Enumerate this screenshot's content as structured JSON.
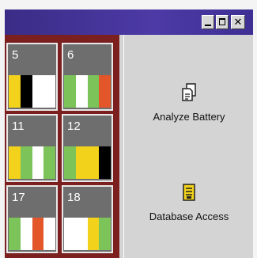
{
  "window": {
    "controls": {
      "minimize": "minimize",
      "maximize": "maximize",
      "close": "✕"
    }
  },
  "cells": [
    {
      "number": "5",
      "slots": [
        "#f2d21b",
        "#000000",
        "#ffffff",
        "#ffffff"
      ]
    },
    {
      "number": "6",
      "slots": [
        "#7cc35a",
        "#ffffff",
        "#7cc35a",
        "#e2562a"
      ]
    },
    {
      "number": "11",
      "slots": [
        "#f2d21b",
        "#7cc35a",
        "#ffffff",
        "#7cc35a"
      ]
    },
    {
      "number": "12",
      "slots": [
        "#7cc35a",
        "#f2d21b",
        "#f2d21b",
        "#000000"
      ]
    },
    {
      "number": "17",
      "slots": [
        "#7cc35a",
        "#ffffff",
        "#e2562a",
        "#ffffff"
      ]
    },
    {
      "number": "18",
      "slots": [
        "#ffffff",
        "#ffffff",
        "#f2d21b",
        "#7cc35a"
      ]
    }
  ],
  "actions": {
    "analyze": {
      "label": "Analyze Battery",
      "icon": "analyze-battery-icon"
    },
    "database": {
      "label": "Database Access",
      "icon": "database-icon"
    }
  }
}
